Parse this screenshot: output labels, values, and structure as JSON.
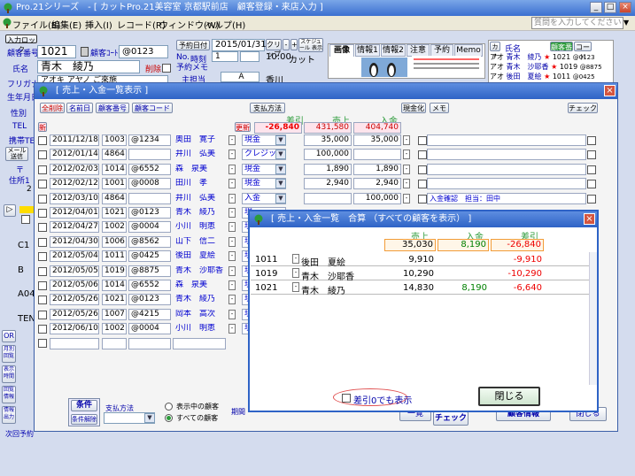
{
  "app": {
    "title": "Pro.21シリーズ　- [ カットPro.21美容室 京都駅前店　顧客登録・来店入力 ]",
    "search_placeholder": "質問を入力してください",
    "btn_min": "_",
    "btn_max": "□",
    "btn_close": "×"
  },
  "menu": [
    "ファイル(E)",
    "編集(E)",
    "挿入(I)",
    "レコード(R)",
    "ウィンドウ(W)",
    "ヘルプ(H)"
  ],
  "customer": {
    "input_lock": "入力ロック",
    "number_label": "顧客番号",
    "number": "1021",
    "code_label": "顧客ｺｰﾄﾞ",
    "code": "@0123",
    "name_label": "氏名",
    "name": "青木　綾乃",
    "delete_label": "削除",
    "kana_label": "フリガナ",
    "kana": "アオキ アヤノ ご來施",
    "birthday_label": "生年月日",
    "gender_label": "性別",
    "tel_label": "TEL",
    "phone_label": "携帯TEL",
    "mail_label": "メール送信",
    "zip_label": "〒",
    "address_label": "住所1",
    "two": "2",
    "c1": "C1",
    "b": "B",
    "a04": "A04",
    "ten": "TEN"
  },
  "visit": {
    "date_btn": "予約日付",
    "date": "2015/01/31",
    "clip": "クリップ",
    "minus": "-",
    "plus": "+",
    "schedule": "スケジュール\n表示",
    "no": "No.",
    "time_label": "時刻",
    "time_no": "1",
    "time": "10:00",
    "service": "カット",
    "memo_label": "予約メモ",
    "staff_label": "主担当",
    "staff_val": "A",
    "staff_name": "香川"
  },
  "tabs": [
    "画像",
    "情報1",
    "情報2",
    "注意",
    "予約",
    "Memo"
  ],
  "recent": {
    "header": "氏名",
    "code_header": "顧客番号",
    "code2_header": "コード",
    "kana_prefix": "アオ",
    "rows": [
      {
        "name": "青木　綾乃",
        "no": "1021",
        "code": "@0123"
      },
      {
        "name": "青木　沙耶香",
        "no": "1019",
        "code": "@8875"
      },
      {
        "name": "後田　夏絵",
        "no": "1011",
        "code": "@0425"
      }
    ]
  },
  "side": {
    "or": "OR",
    "btn1": "月別\n回覧",
    "btn2": "表示\n時間",
    "btn3": "回覧\n情報",
    "btn4": "情報\n出力",
    "next": "次回予約"
  },
  "win1": {
    "title": "[ 売上・入金一覧表示 ]",
    "btns": [
      "全削除",
      "名前日",
      "顧客番号",
      "顧客コード",
      "支払方法",
      "現金化",
      "メモ",
      "チェック"
    ],
    "new_btn": "新",
    "update_btn": "更新",
    "col_heads": {
      "diff": "差引",
      "sales": "売上",
      "deposit": "入金"
    },
    "totals": {
      "diff": "-26,840",
      "sales": "431,580",
      "deposit": "404,740"
    },
    "rows": [
      {
        "date": "2011/12/18",
        "no": "1003",
        "code": "@1234",
        "name": "奥田　寛子",
        "pay": "現金",
        "sales": "35,000",
        "deposit": "35,000",
        "memo": ""
      },
      {
        "date": "2012/01/14",
        "no": "4864",
        "code": "",
        "name": "井川　弘美",
        "pay": "クレジット",
        "sales": "100,000",
        "deposit": "",
        "memo": ""
      },
      {
        "date": "2012/02/03",
        "no": "1014",
        "code": "@6552",
        "name": "森　泉美",
        "pay": "現金",
        "sales": "1,890",
        "deposit": "1,890",
        "memo": ""
      },
      {
        "date": "2012/02/12",
        "no": "1001",
        "code": "@0008",
        "name": "田川　孝",
        "pay": "現金",
        "sales": "2,940",
        "deposit": "2,940",
        "memo": ""
      },
      {
        "date": "2012/03/10",
        "no": "4864",
        "code": "",
        "name": "井川　弘美",
        "pay": "入金",
        "sales": "",
        "deposit": "100,000",
        "memo": "入金確認　担当：田中"
      },
      {
        "date": "2012/04/01",
        "no": "1021",
        "code": "@0123",
        "name": "青木　綾乃",
        "pay": "現",
        "sales": "",
        "deposit": "",
        "memo": ""
      },
      {
        "date": "2012/04/27",
        "no": "1002",
        "code": "@0004",
        "name": "小川　明恵",
        "pay": "現",
        "sales": "",
        "deposit": "",
        "memo": ""
      },
      {
        "date": "2012/04/30",
        "no": "1006",
        "code": "@8562",
        "name": "山下　信二",
        "pay": "現",
        "sales": "",
        "deposit": "",
        "memo": ""
      },
      {
        "date": "2012/05/04",
        "no": "1011",
        "code": "@0425",
        "name": "後田　夏絵",
        "pay": "現",
        "sales": "",
        "deposit": "",
        "memo": ""
      },
      {
        "date": "2012/05/05",
        "no": "1019",
        "code": "@8875",
        "name": "青木　沙耶香",
        "pay": "現",
        "sales": "",
        "deposit": "",
        "memo": ""
      },
      {
        "date": "2012/05/06",
        "no": "1014",
        "code": "@6552",
        "name": "森　泉美",
        "pay": "現",
        "sales": "",
        "deposit": "",
        "memo": ""
      },
      {
        "date": "2012/05/26",
        "no": "1021",
        "code": "@0123",
        "name": "青木　綾乃",
        "pay": "現",
        "sales": "",
        "deposit": "",
        "memo": ""
      },
      {
        "date": "2012/05/26",
        "no": "1007",
        "code": "@4215",
        "name": "岡本　高次",
        "pay": "現",
        "sales": "",
        "deposit": "",
        "memo": ""
      },
      {
        "date": "2012/06/10",
        "no": "1002",
        "code": "@0004",
        "name": "小川　明恵",
        "pay": "現",
        "sales": "",
        "deposit": "",
        "memo": ""
      }
    ],
    "cond_btn": "条件",
    "cond_clear": "条件解除",
    "pay_label": "支払方法",
    "radio1": "表示中の顧客",
    "radio2": "すべての顧客",
    "period_label": "期間",
    "period_from": "2011/01/01",
    "period_to": "2015/01/01",
    "list_btn": "一覧",
    "check_btn": "チェック",
    "customer_info_btn": "顧客情報",
    "close_btn": "閉じる"
  },
  "win2": {
    "title": "[ 売上・入金一覧　合算 （すべての顧客を表示） ]",
    "heads": {
      "sales": "売上",
      "deposit": "入金",
      "diff": "差引"
    },
    "totals": {
      "sales": "35,030",
      "deposit": "8,190",
      "diff": "-26,840"
    },
    "rows": [
      {
        "no": "1011",
        "name": "後田　夏絵",
        "sales": "9,910",
        "deposit": "",
        "diff": "-9,910"
      },
      {
        "no": "1019",
        "name": "青木　沙耶香",
        "sales": "10,290",
        "deposit": "",
        "diff": "-10,290"
      },
      {
        "no": "1021",
        "name": "青木　綾乃",
        "sales": "14,830",
        "deposit": "8,190",
        "diff": "-6,640"
      }
    ],
    "diff_only": "差引0でも表示",
    "close": "閉じる"
  },
  "colors": {
    "title_blue": "#2e63c6",
    "diff_red": "#e00000",
    "deposit_green": "#008000",
    "highlight_orange": "#f29c38"
  }
}
